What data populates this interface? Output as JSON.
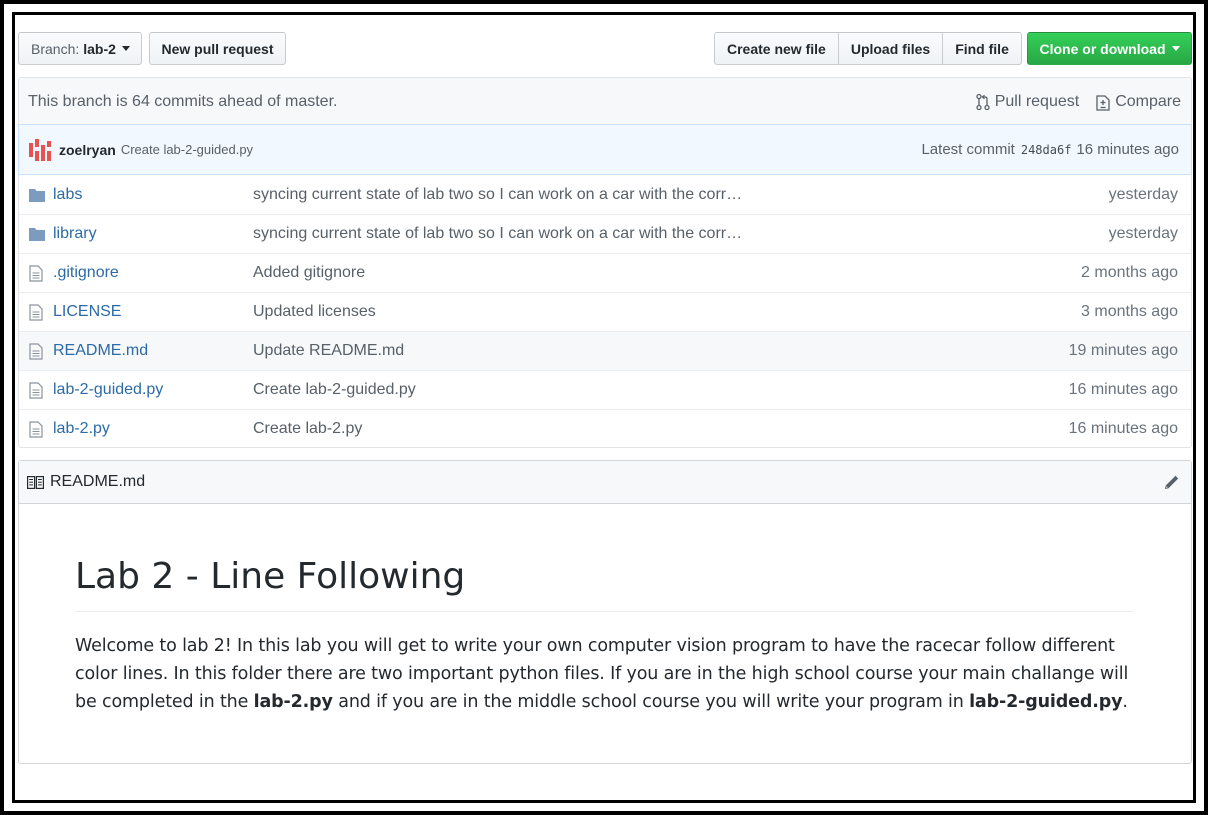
{
  "toolbar": {
    "branch_prefix": "Branch:",
    "branch_name": "lab-2",
    "new_pull_request": "New pull request",
    "create_new_file": "Create new file",
    "upload_files": "Upload files",
    "find_file": "Find file",
    "clone_or_download": "Clone or download"
  },
  "branch_info": {
    "status": "This branch is 64 commits ahead of master.",
    "pull_request": "Pull request",
    "compare": "Compare"
  },
  "latest_commit": {
    "author": "zoelryan",
    "message": "Create lab-2-guided.py",
    "label": "Latest commit",
    "sha": "248da6f",
    "age": "16 minutes ago"
  },
  "files": [
    {
      "type": "folder",
      "icon": "folder-icon",
      "name": "labs",
      "message": "syncing current state of lab two so I can work on a car with the corr…",
      "age": "yesterday"
    },
    {
      "type": "folder",
      "icon": "folder-icon",
      "name": "library",
      "message": "syncing current state of lab two so I can work on a car with the corr…",
      "age": "yesterday"
    },
    {
      "type": "file",
      "icon": "file-icon",
      "name": ".gitignore",
      "message": "Added gitignore",
      "age": "2 months ago"
    },
    {
      "type": "file",
      "icon": "file-icon",
      "name": "LICENSE",
      "message": "Updated licenses",
      "age": "3 months ago"
    },
    {
      "type": "file",
      "icon": "file-icon",
      "name": "README.md",
      "message": "Update README.md",
      "age": "19 minutes ago"
    },
    {
      "type": "file",
      "icon": "file-icon",
      "name": "lab-2-guided.py",
      "message": "Create lab-2-guided.py",
      "age": "16 minutes ago"
    },
    {
      "type": "file",
      "icon": "file-icon",
      "name": "lab-2.py",
      "message": "Create lab-2.py",
      "age": "16 minutes ago"
    }
  ],
  "readme": {
    "filename": "README.md",
    "heading": "Lab 2 - Line Following",
    "para_1": "Welcome to lab 2! In this lab you will get to write your own computer vision program to have the racecar follow different color lines. In this folder there are two important python files. If you are in the high school course your main challange will be completed in the ",
    "bold_1": "lab-2.py",
    "para_2": " and if you are in the middle school course you will write your program in ",
    "bold_2": "lab-2-guided.py",
    "para_3": "."
  },
  "colors": {
    "link": "#2c6aa8",
    "green_button": "#28a745",
    "commit_bar_bg": "#f1f8ff",
    "avatar_red": "#e8534f"
  }
}
